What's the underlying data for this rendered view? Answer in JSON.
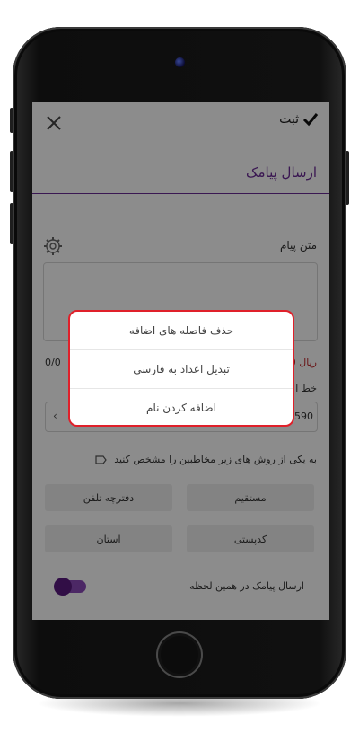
{
  "topbar": {
    "save_label": "ثبت"
  },
  "tab": {
    "title": "ارسال پیامک"
  },
  "message": {
    "label": "متن پیام",
    "counter": "0/0",
    "price_label": "0 ریال"
  },
  "line": {
    "label": "خط ا",
    "value": "590"
  },
  "recipients": {
    "instruction": "به یکی از روش های زیر مخاطبین را مشخص کنید",
    "buttons": [
      "مستقیم",
      "دفترچه تلفن",
      "کدپستی",
      "استان"
    ]
  },
  "send_now": {
    "label": "ارسال پیامک در همین لحظه",
    "enabled": true
  },
  "popup": {
    "items": [
      "حذف فاصله های اضافه",
      "تبدیل اعداد به فارسی",
      "اضافه کردن نام"
    ]
  },
  "colors": {
    "accent": "#6a2a96",
    "highlight_border": "#e0202a",
    "price": "#c0282d"
  }
}
